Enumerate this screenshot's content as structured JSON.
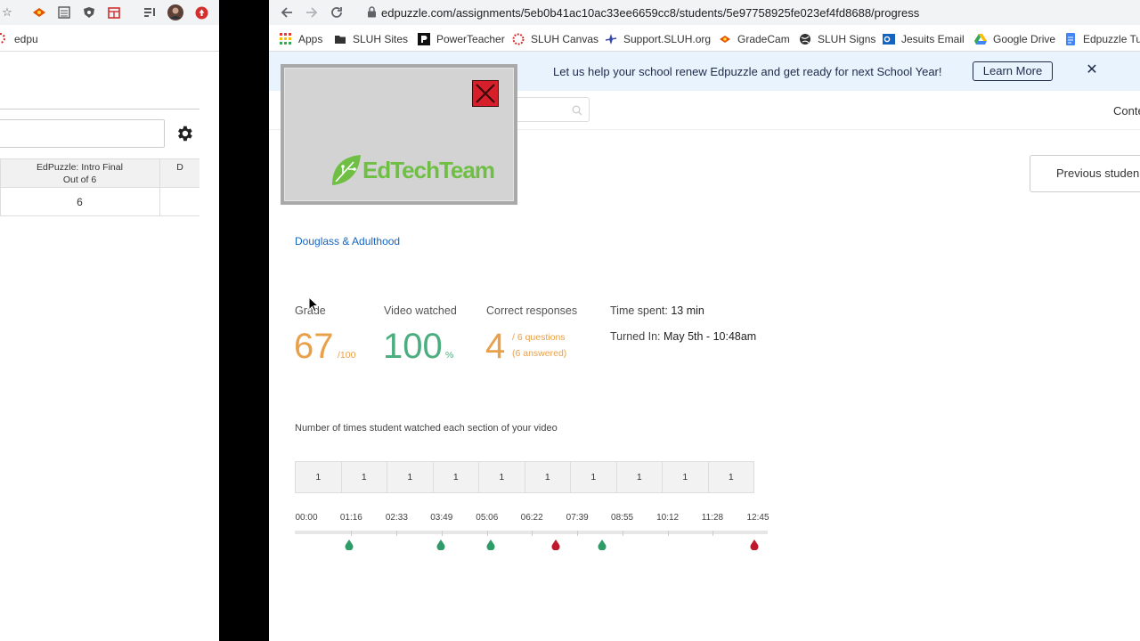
{
  "left_window": {
    "bookmark_label": "edpu",
    "table": {
      "header_title": "EdPuzzle: Intro Final",
      "header_subtitle": "Out of 6",
      "header_next": "D",
      "cell_value": "6"
    }
  },
  "browser": {
    "url": "edpuzzle.com/assignments/5eb0b41ac10ac33ee6659cc8/students/5e97758925fe023ef4fd8688/progress",
    "bookmarks": [
      {
        "label": "Apps",
        "icon": "apps-grid-icon",
        "color": "#e53935"
      },
      {
        "label": "SLUH Sites",
        "icon": "folder-icon",
        "color": "#333333"
      },
      {
        "label": "PowerTeacher",
        "icon": "powerteacher-icon",
        "color": "#111111"
      },
      {
        "label": "SLUH Canvas",
        "icon": "canvas-icon",
        "color": "#d32f2f"
      },
      {
        "label": "Support.SLUH.org",
        "icon": "support-icon",
        "color": "#3949ab"
      },
      {
        "label": "GradeCam",
        "icon": "gradecam-icon",
        "color": "#e65100"
      },
      {
        "label": "SLUH Signs",
        "icon": "globe-icon",
        "color": "#333333"
      },
      {
        "label": "Jesuits Email",
        "icon": "outlook-icon",
        "color": "#1565c0"
      },
      {
        "label": "Google Drive",
        "icon": "drive-icon",
        "color": "#fbbc04"
      },
      {
        "label": "Edpuzzle Tut",
        "icon": "docs-icon",
        "color": "#4285f4"
      }
    ]
  },
  "banner": {
    "text": "Let us help your school renew Edpuzzle and get ready for next School Year!",
    "button": "Learn More",
    "close": "✕"
  },
  "topnav": {
    "content_label": "Conte"
  },
  "previous_student": "Previous studen",
  "video_title": "Douglass & Adulthood",
  "stats": {
    "grade_label": "Grade",
    "grade_value": "67",
    "grade_suffix": "/100",
    "watched_label": "Video watched",
    "watched_value": "100",
    "watched_suffix": "%",
    "correct_label": "Correct responses",
    "correct_value": "4",
    "correct_suffix_1": "/ 6 questions",
    "correct_suffix_2": "(6 answered)",
    "time_spent_label": "Time spent:",
    "time_spent_value": "13 min",
    "turned_in_label": "Turned In:",
    "turned_in_value": "May 5th - 10:48am"
  },
  "colors": {
    "grade": "#e8a04a",
    "watched": "#4cae7f",
    "correct": "#e8a04a",
    "marker_correct": "#2e9b68",
    "marker_wrong": "#c0182b"
  },
  "watch_caption": "Number of times student watched each section of your video",
  "watch_counts": [
    "1",
    "1",
    "1",
    "1",
    "1",
    "1",
    "1",
    "1",
    "1",
    "1"
  ],
  "timeline": {
    "labels": [
      "00:00",
      "01:16",
      "02:33",
      "03:49",
      "05:06",
      "06:22",
      "07:39",
      "08:55",
      "10:12",
      "11:28",
      "12:45"
    ],
    "markers": [
      {
        "time": "01:13",
        "status": "correct"
      },
      {
        "time": "03:48",
        "status": "correct"
      },
      {
        "time": "05:12",
        "status": "correct"
      },
      {
        "time": "07:02",
        "status": "wrong"
      },
      {
        "time": "08:21",
        "status": "correct"
      },
      {
        "time": "12:39",
        "status": "wrong"
      }
    ]
  },
  "overlay": {
    "logo_text": "EdTechTeam"
  }
}
